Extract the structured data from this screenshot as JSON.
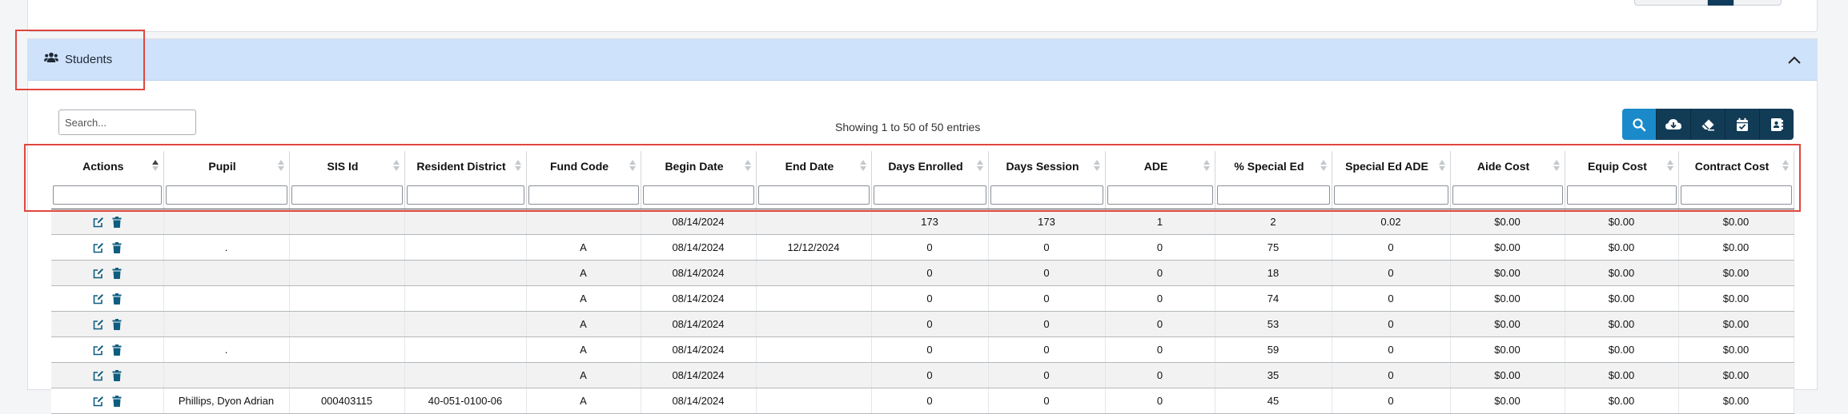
{
  "section": {
    "title": "Students",
    "icon": "users-icon",
    "collapse_icon": "chevron-up-icon"
  },
  "search": {
    "placeholder": "Search..."
  },
  "info": {
    "text": "Showing 1 to 50 of 50 entries"
  },
  "toolbar": {
    "buttons": [
      {
        "name": "search-toggle-button",
        "icon": "search-icon"
      },
      {
        "name": "download-button",
        "icon": "cloud-download-icon"
      },
      {
        "name": "clear-filters-button",
        "icon": "eraser-icon"
      },
      {
        "name": "date-button",
        "icon": "calendar-check-icon"
      },
      {
        "name": "columns-button",
        "icon": "id-card-icon"
      }
    ],
    "active_color": "#1a8acb",
    "color": "#123b56"
  },
  "columns": [
    "Actions",
    "Pupil",
    "SIS Id",
    "Resident District",
    "Fund Code",
    "Begin Date",
    "End Date",
    "Days Enrolled",
    "Days Session",
    "ADE",
    "% Special Ed",
    "Special Ed ADE",
    "Aide Cost",
    "Equip Cost",
    "Contract Cost"
  ],
  "rows": [
    [
      "",
      "",
      "",
      "",
      "",
      "08/14/2024",
      "",
      "173",
      "173",
      "1",
      "2",
      "0.02",
      "$0.00",
      "$0.00",
      "$0.00"
    ],
    [
      "",
      ".",
      "",
      "",
      "A",
      "08/14/2024",
      "12/12/2024",
      "0",
      "0",
      "0",
      "75",
      "0",
      "$0.00",
      "$0.00",
      "$0.00"
    ],
    [
      "",
      "",
      "",
      "",
      "A",
      "08/14/2024",
      "",
      "0",
      "0",
      "0",
      "18",
      "0",
      "$0.00",
      "$0.00",
      "$0.00"
    ],
    [
      "",
      "",
      "",
      "",
      "A",
      "08/14/2024",
      "",
      "0",
      "0",
      "0",
      "74",
      "0",
      "$0.00",
      "$0.00",
      "$0.00"
    ],
    [
      "",
      "",
      "",
      "",
      "A",
      "08/14/2024",
      "",
      "0",
      "0",
      "0",
      "53",
      "0",
      "$0.00",
      "$0.00",
      "$0.00"
    ],
    [
      "",
      ".",
      "",
      "",
      "A",
      "08/14/2024",
      "",
      "0",
      "0",
      "0",
      "59",
      "0",
      "$0.00",
      "$0.00",
      "$0.00"
    ],
    [
      "",
      "",
      "",
      "",
      "A",
      "08/14/2024",
      "",
      "0",
      "0",
      "0",
      "35",
      "0",
      "$0.00",
      "$0.00",
      "$0.00"
    ],
    [
      "",
      "Phillips, Dyon Adrian",
      "000403115",
      "40-051-0100-06",
      "A",
      "08/14/2024",
      "",
      "0",
      "0",
      "0",
      "45",
      "0",
      "$0.00",
      "$0.00",
      "$0.00"
    ]
  ]
}
